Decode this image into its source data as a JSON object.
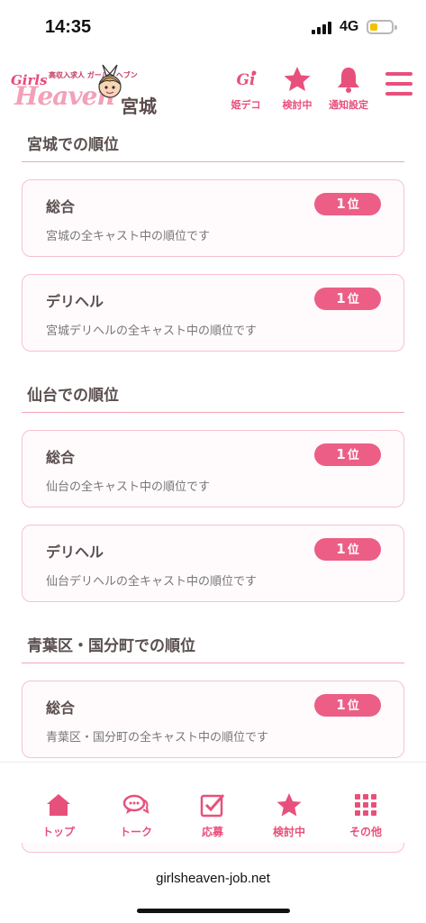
{
  "status": {
    "time": "14:35",
    "network": "4G"
  },
  "header": {
    "logo_text": "Girls Heaven",
    "logo_tagline": "高収入求人 ガールズヘブン",
    "region": "宮城",
    "buttons": [
      {
        "label": "姫デコ",
        "icon": "hime-deco-icon"
      },
      {
        "label": "検討中",
        "icon": "star-icon"
      },
      {
        "label": "通知設定",
        "icon": "bell-icon"
      }
    ],
    "menu_icon": "hamburger-menu-icon"
  },
  "sections": [
    {
      "title": "宮城での順位",
      "cards": [
        {
          "name": "総合",
          "desc": "宮城の全キャスト中の順位です",
          "rank": "1",
          "unit": "位"
        },
        {
          "name": "デリヘル",
          "desc": "宮城デリヘルの全キャスト中の順位です",
          "rank": "1",
          "unit": "位"
        }
      ]
    },
    {
      "title": "仙台での順位",
      "cards": [
        {
          "name": "総合",
          "desc": "仙台の全キャスト中の順位です",
          "rank": "1",
          "unit": "位"
        },
        {
          "name": "デリヘル",
          "desc": "仙台デリヘルの全キャスト中の順位です",
          "rank": "1",
          "unit": "位"
        }
      ]
    },
    {
      "title": "青葉区・国分町での順位",
      "cards": [
        {
          "name": "総合",
          "desc": "青葉区・国分町の全キャスト中の順位です",
          "rank": "1",
          "unit": "位"
        }
      ]
    }
  ],
  "bottom_nav": [
    {
      "label": "トップ",
      "icon": "home-icon"
    },
    {
      "label": "トーク",
      "icon": "chat-icon"
    },
    {
      "label": "応募",
      "icon": "apply-check-icon"
    },
    {
      "label": "検討中",
      "icon": "star-icon"
    },
    {
      "label": "その他",
      "icon": "grid-icon"
    }
  ],
  "browser": {
    "url": "girlsheaven-job.net"
  },
  "colors": {
    "accent": "#e8507c",
    "badge": "#ec5e86",
    "card_border": "#f6c2cc",
    "divider": "#f0a6b6"
  }
}
